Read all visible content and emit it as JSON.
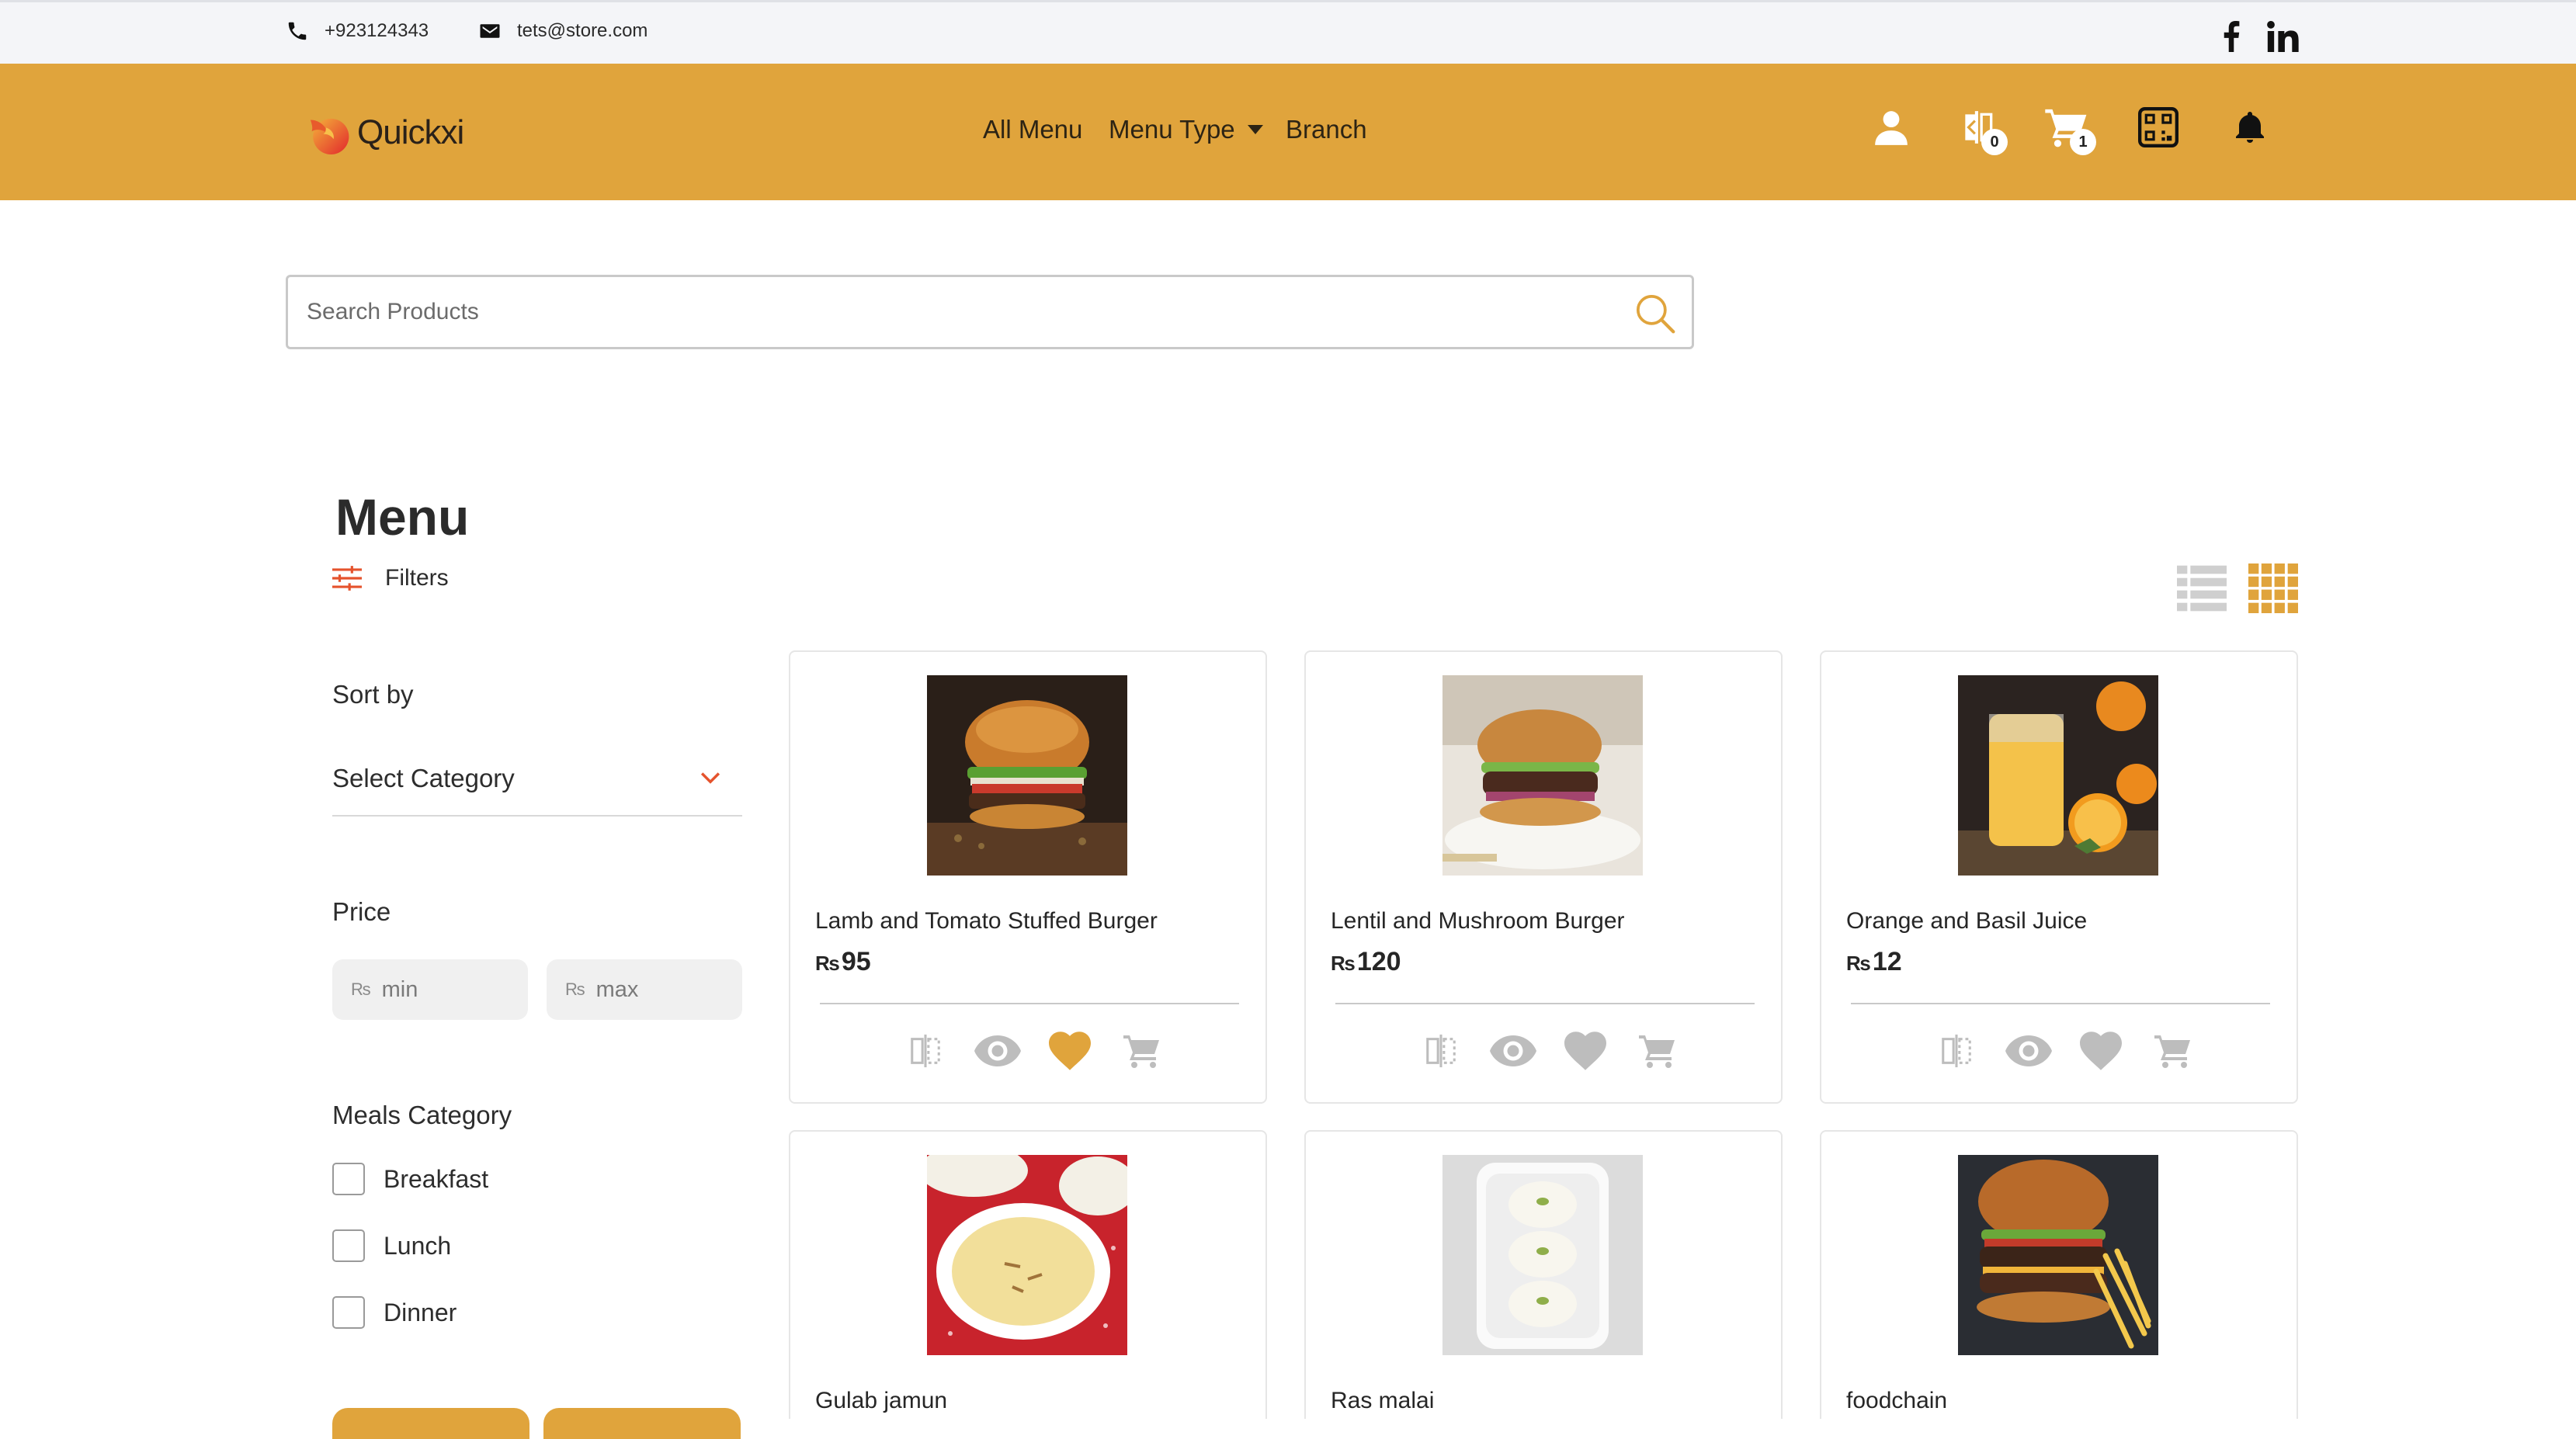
{
  "topbar": {
    "phone": "+923124343",
    "email": "tets@store.com",
    "social": [
      "facebook-icon",
      "linkedin-icon"
    ]
  },
  "header": {
    "logo_text": "Quickxi",
    "nav": {
      "all_menu": "All Menu",
      "menu_type": "Menu Type",
      "branch": "Branch"
    },
    "icons": {
      "compare_count": "0",
      "cart_count": "1"
    },
    "accent_color": "#e0a43c"
  },
  "search": {
    "placeholder": "Search Products"
  },
  "page": {
    "title": "Menu",
    "filters_label": "Filters"
  },
  "sidebar": {
    "sort_by_label": "Sort by",
    "select_category": "Select Category",
    "price_label": "Price",
    "price_min_placeholder": "min",
    "price_max_placeholder": "max",
    "currency_symbol": "₨",
    "meals_category_label": "Meals Category",
    "meals": [
      {
        "label": "Breakfast",
        "checked": false
      },
      {
        "label": "Lunch",
        "checked": false
      },
      {
        "label": "Dinner",
        "checked": false
      }
    ]
  },
  "products": [
    {
      "name": "Lamb and Tomato Stuffed Burger",
      "currency": "₨",
      "price": "95",
      "favorited": true
    },
    {
      "name": "Lentil and Mushroom Burger",
      "currency": "₨",
      "price": "120",
      "favorited": false
    },
    {
      "name": "Orange and Basil Juice",
      "currency": "₨",
      "price": "12",
      "favorited": false
    },
    {
      "name": "Gulab jamun"
    },
    {
      "name": "Ras malai"
    },
    {
      "name": "foodchain"
    }
  ],
  "view_mode": "grid"
}
